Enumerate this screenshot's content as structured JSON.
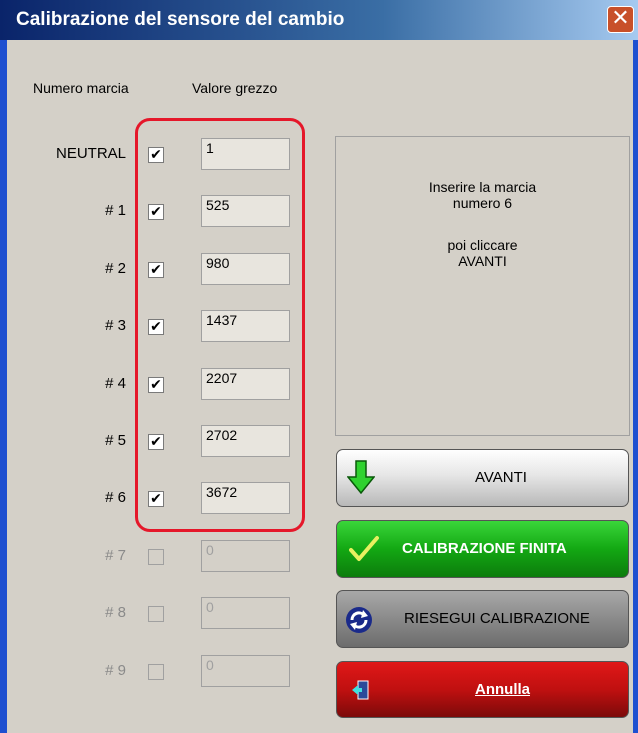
{
  "window": {
    "title": "Calibrazione del sensore del cambio",
    "close_glyph": "✕"
  },
  "headers": {
    "gear_number": "Numero marcia",
    "raw_value": "Valore grezzo"
  },
  "rows": [
    {
      "label": "NEUTRAL",
      "checked": true,
      "value": "1",
      "enabled": true
    },
    {
      "label": "# 1",
      "checked": true,
      "value": "525",
      "enabled": true
    },
    {
      "label": "# 2",
      "checked": true,
      "value": "980",
      "enabled": true
    },
    {
      "label": "# 3",
      "checked": true,
      "value": "1437",
      "enabled": true
    },
    {
      "label": "# 4",
      "checked": true,
      "value": "2207",
      "enabled": true
    },
    {
      "label": "# 5",
      "checked": true,
      "value": "2702",
      "enabled": true
    },
    {
      "label": "# 6",
      "checked": true,
      "value": "3672",
      "enabled": true
    },
    {
      "label": "# 7",
      "checked": false,
      "value": "0",
      "enabled": false
    },
    {
      "label": "# 8",
      "checked": false,
      "value": "0",
      "enabled": false
    },
    {
      "label": "# 9",
      "checked": false,
      "value": "0",
      "enabled": false
    }
  ],
  "check_glyph": "✔",
  "instructions": {
    "line1": "Inserire la marcia",
    "line2": "numero 6",
    "line3": "poi cliccare",
    "line4": "AVANTI"
  },
  "buttons": {
    "next": "AVANTI",
    "finish": "CALIBRAZIONE FINITA",
    "redo": "RIESEGUI CALIBRAZIONE",
    "cancel": "Annulla"
  },
  "colors": {
    "highlight": "#e5172a",
    "finish_green": "#10a010",
    "cancel_red": "#c41010",
    "title_blue": "#0a246a"
  },
  "icons": {
    "next": "arrow-down-icon",
    "finish": "checkmark-icon",
    "redo": "refresh-icon",
    "cancel": "exit-door-icon",
    "close": "close-icon"
  }
}
